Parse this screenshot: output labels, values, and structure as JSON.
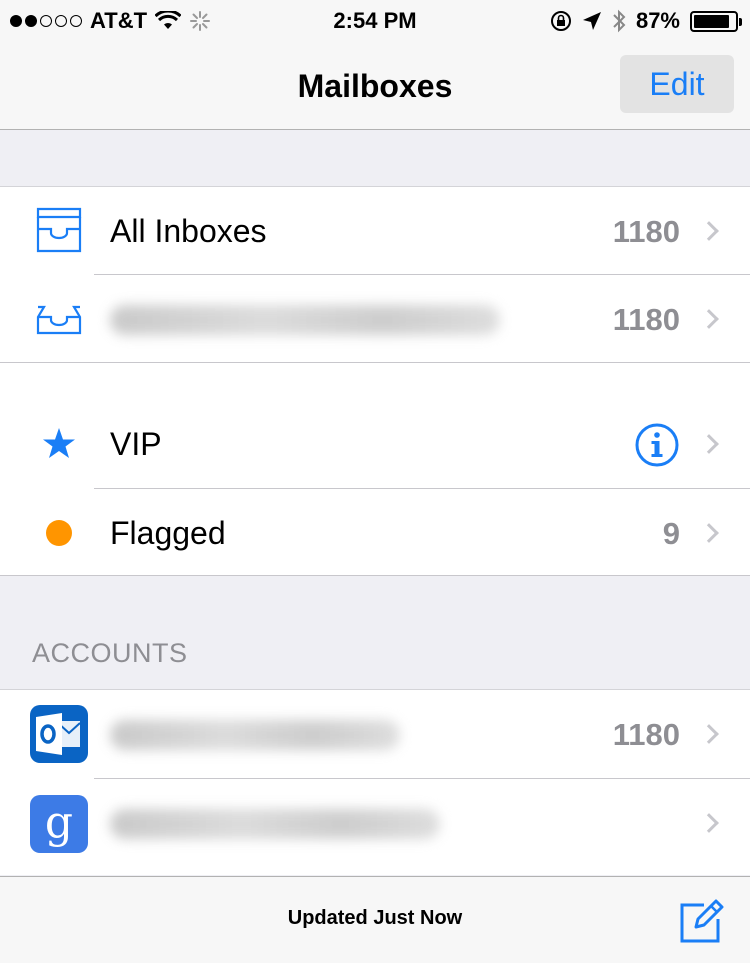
{
  "status_bar": {
    "carrier": "AT&T",
    "time": "2:54 PM",
    "battery": "87%",
    "battery_level": 0.87,
    "signal_bars": 2,
    "signal_total": 5
  },
  "nav": {
    "title": "Mailboxes",
    "edit_label": "Edit"
  },
  "mailboxes": {
    "all_inboxes": {
      "label": "All Inboxes",
      "count": "1180"
    },
    "account_inbox": {
      "count": "1180"
    },
    "vip": {
      "label": "VIP"
    },
    "flagged": {
      "label": "Flagged",
      "count": "9"
    }
  },
  "accounts": {
    "header": "ACCOUNTS",
    "outlook": {
      "count": "1180"
    },
    "google": {
      "glyph": "g"
    }
  },
  "toolbar": {
    "status": "Updated Just Now"
  },
  "colors": {
    "accent": "#1a7ef6",
    "vip_star": "#1a7ef6",
    "flagged_dot": "#ff9500",
    "outlook_blue": "#0a64c4",
    "google_blue": "#3d7be6"
  },
  "icons": [
    "signal-dots-icon",
    "wifi-icon",
    "activity-spinner-icon",
    "orientation-lock-icon",
    "location-icon",
    "bluetooth-icon",
    "battery-icon",
    "inbox-tray-icon",
    "star-icon",
    "flag-dot-icon",
    "info-icon",
    "chevron-right-icon",
    "outlook-icon",
    "google-icon",
    "compose-icon"
  ]
}
